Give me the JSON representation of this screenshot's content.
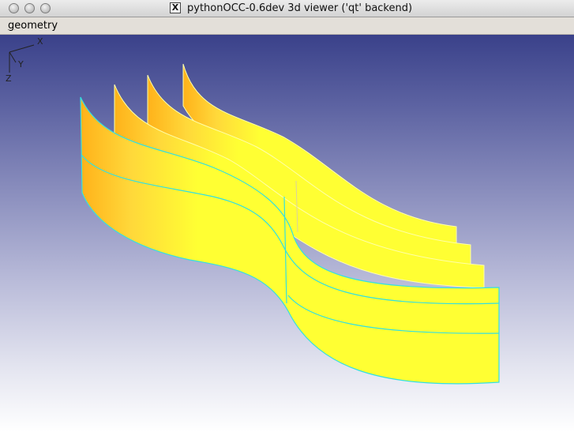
{
  "window": {
    "title": "pythonOCC-0.6dev 3d viewer ('qt' backend)",
    "x_icon_glyph": "X"
  },
  "menubar": {
    "items": [
      {
        "label_mnemonic": "g",
        "label_rest": "eometry"
      }
    ]
  },
  "viewer": {
    "background_top": "#3a418a",
    "background_bottom": "#ffffff",
    "surface_color": "#ffff33",
    "surface_shade": "#ffb21a",
    "edge_color": "#33e0e0",
    "triad": {
      "x_label": "X",
      "y_label": "Y",
      "z_label": "Z"
    }
  }
}
